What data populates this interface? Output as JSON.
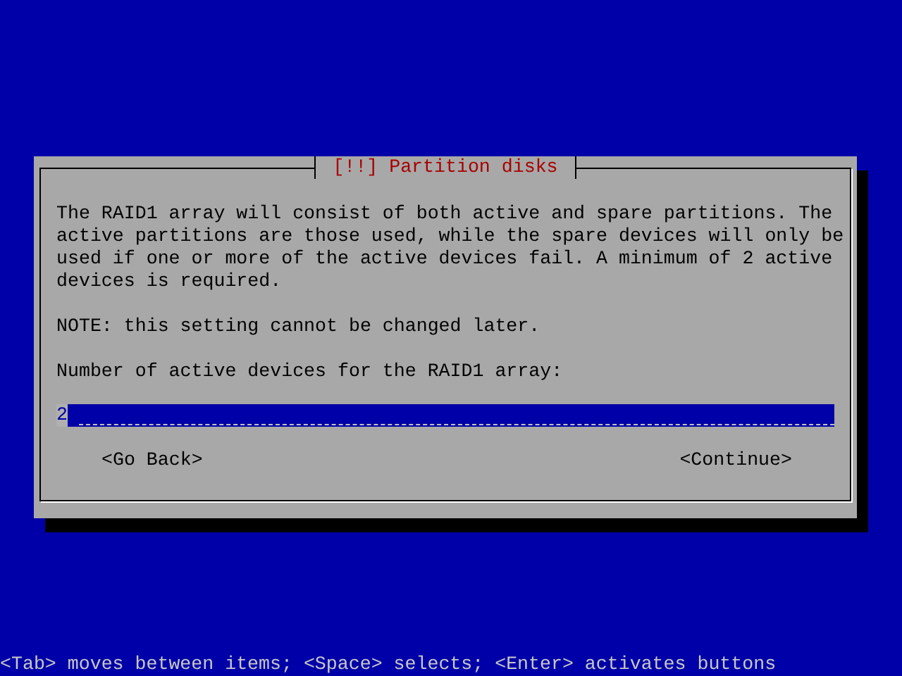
{
  "dialog": {
    "title": "[!!] Partition disks",
    "paragraphs": [
      "The RAID1 array will consist of both active and spare partitions. The active partitions are those used, while the spare devices will only be used if one or more of the active devices fail. A minimum of 2 active devices is required.",
      "NOTE: this setting cannot be changed later."
    ],
    "field_label": "Number of active devices for the RAID1 array:",
    "field": {
      "value": "2"
    },
    "buttons": [
      {
        "label": "<Go Back>"
      },
      {
        "label": "<Continue>"
      }
    ]
  },
  "status_bar": "<Tab> moves between items; <Space> selects; <Enter> activates buttons"
}
